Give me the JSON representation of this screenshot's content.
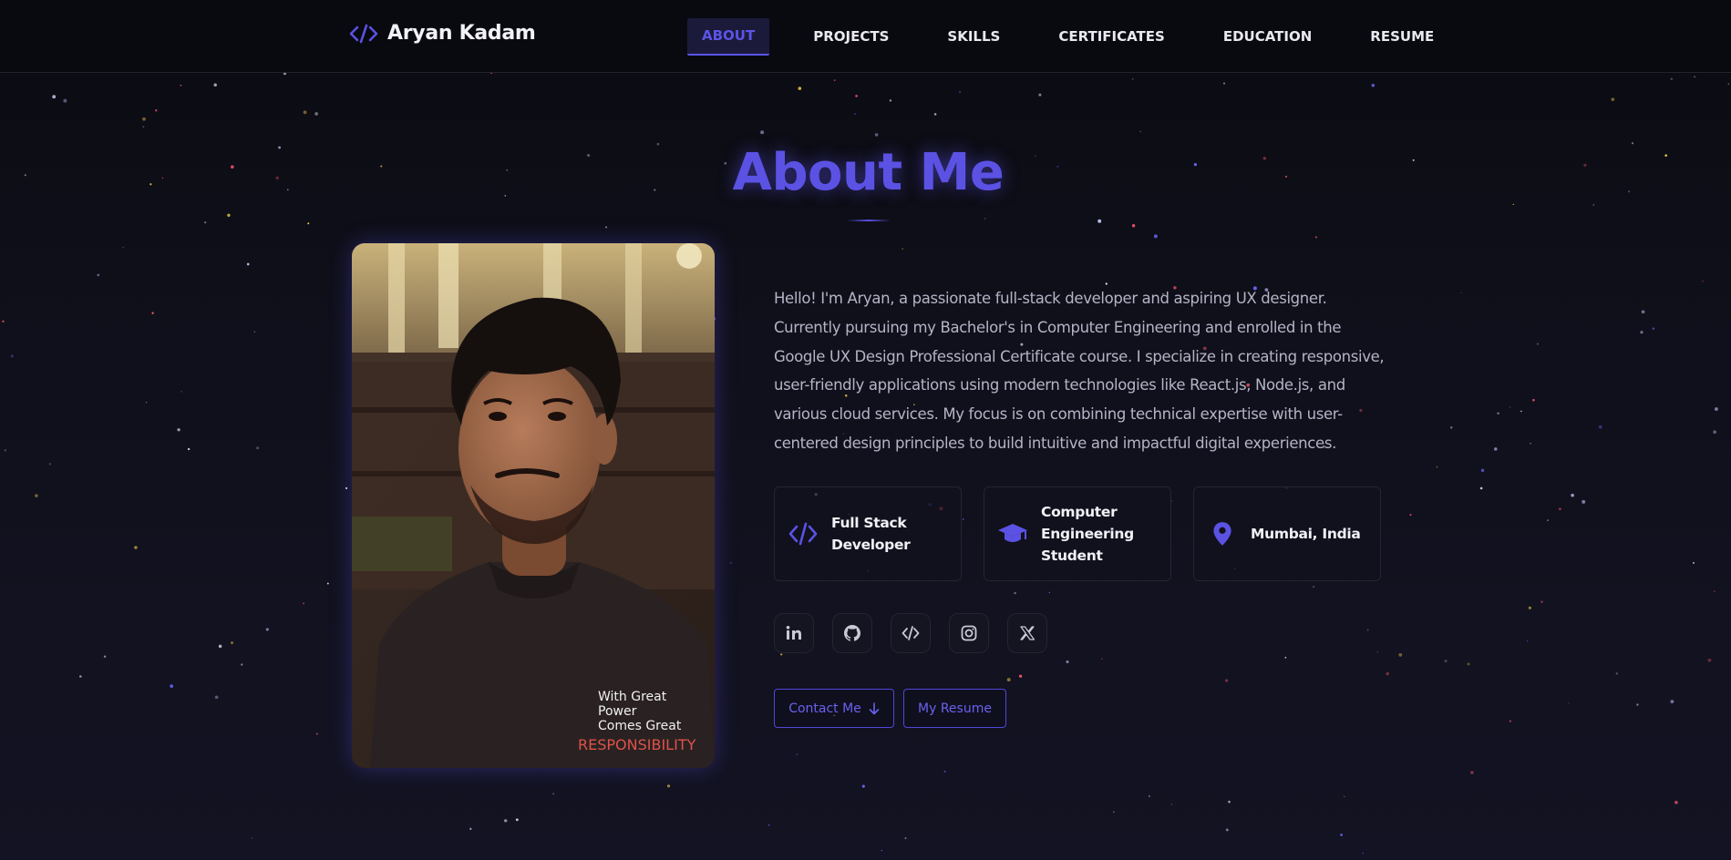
{
  "brand": {
    "icon": "code-brackets-icon",
    "name": "Aryan Kadam"
  },
  "nav": {
    "items": [
      {
        "label": "ABOUT",
        "active": true
      },
      {
        "label": "PROJECTS",
        "active": false
      },
      {
        "label": "SKILLS",
        "active": false
      },
      {
        "label": "CERTIFICATES",
        "active": false
      },
      {
        "label": "EDUCATION",
        "active": false
      },
      {
        "label": "RESUME",
        "active": false
      }
    ]
  },
  "about": {
    "title": "About Me",
    "photo_alt": "Portrait of Aryan Kadam",
    "photo_shirt_text": [
      "With Great",
      "Power",
      "Comes Great",
      "RESPONSIBILITY"
    ],
    "bio_lines": [
      "Hello! I'm Aryan, a passionate full-stack developer and aspiring UX designer.",
      "Currently pursuing my Bachelor's in Computer Engineering and enrolled in the",
      "Google UX Design Professional Certificate course. I specialize in creating responsive,",
      "user-friendly applications using modern technologies like React.js, Node.js, and",
      "various cloud services. My focus is on combining technical expertise with user-",
      "centered design principles to build intuitive and impactful digital experiences."
    ],
    "cards": [
      {
        "icon": "code-icon",
        "lines": [
          "Full Stack",
          "Developer"
        ]
      },
      {
        "icon": "graduation-cap-icon",
        "lines": [
          "Computer",
          "Engineering",
          "Student"
        ]
      },
      {
        "icon": "map-pin-icon",
        "lines": [
          "Mumbai, India"
        ]
      }
    ],
    "socials": [
      {
        "icon": "linkedin-icon"
      },
      {
        "icon": "github-icon"
      },
      {
        "icon": "code-icon"
      },
      {
        "icon": "instagram-icon"
      },
      {
        "icon": "x-twitter-icon"
      }
    ],
    "buttons": {
      "contact_label": "Contact Me",
      "contact_icon": "arrow-down-icon",
      "resume_label": "My Resume"
    }
  },
  "colors": {
    "accent": "#5b52e4",
    "background": "#0d0d16",
    "text_muted": "#b4b4c6",
    "card_border": "#242433"
  }
}
